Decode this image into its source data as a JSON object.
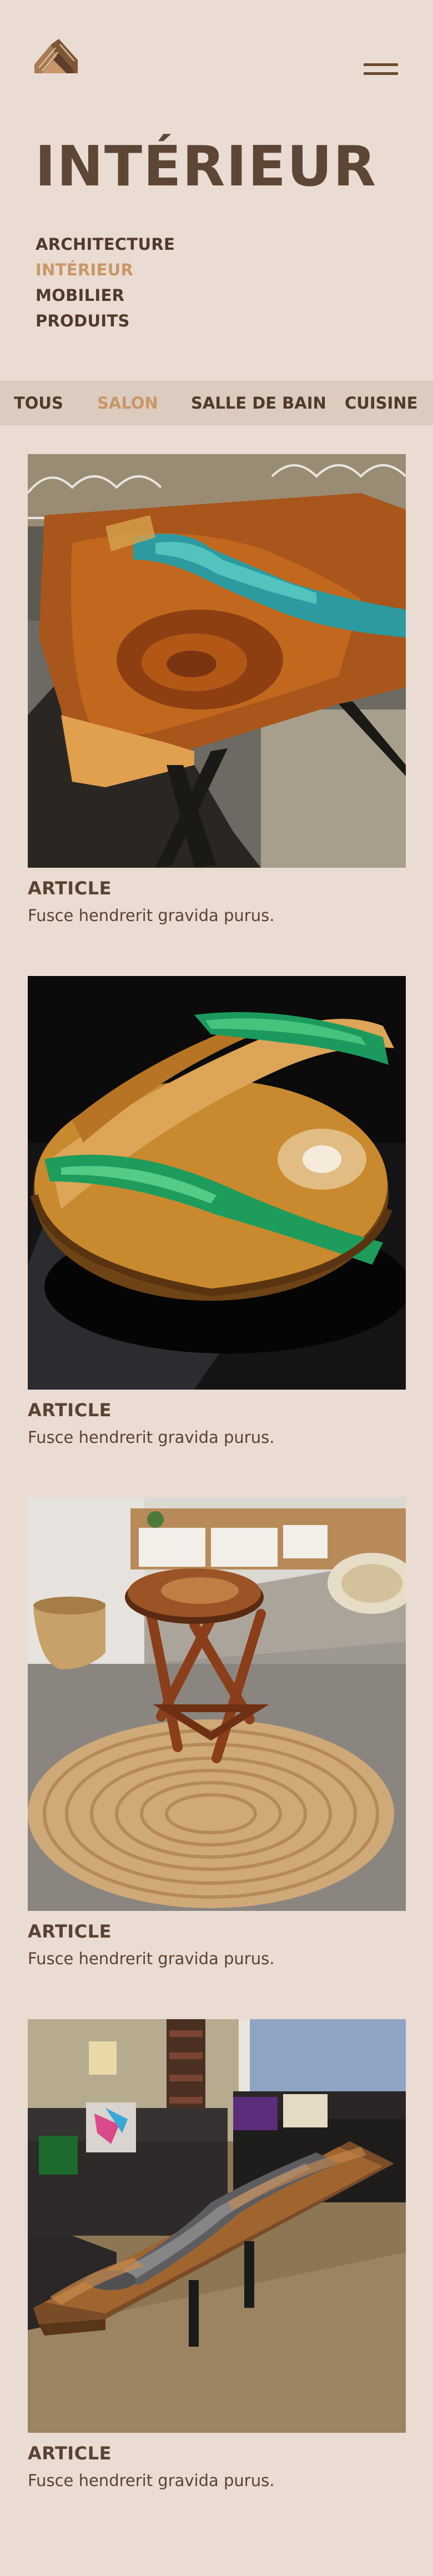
{
  "header": {
    "logo": "stacked-wood-planks-logo",
    "menu_icon": "hamburger-menu-icon",
    "title": "INTÉRIEUR"
  },
  "categories": [
    {
      "label": "ARCHITECTURE",
      "active": false
    },
    {
      "label": "INTÉRIEUR",
      "active": true
    },
    {
      "label": "MOBILIER",
      "active": false
    },
    {
      "label": "PRODUITS",
      "active": false
    }
  ],
  "tabs": [
    {
      "label": "TOUS",
      "active": false
    },
    {
      "label": "SALON",
      "active": true
    },
    {
      "label": "SALLE DE BAIN",
      "active": false
    },
    {
      "label": "CUISINE",
      "active": false
    }
  ],
  "articles": [
    {
      "title": "ARTICLE",
      "text": "Fusce hendrerit gravida purus.",
      "image": "live-edge wood table with turquoise resin river"
    },
    {
      "title": "ARTICLE",
      "text": "Fusce hendrerit gravida purus.",
      "image": "round wood table with green resin stripes"
    },
    {
      "title": "ARTICLE",
      "text": "Fusce hendrerit gravida purus.",
      "image": "round resin side table on jute rug"
    },
    {
      "title": "ARTICLE",
      "text": "Fusce hendrerit gravida purus.",
      "image": "walnut river coffee table in living room"
    }
  ],
  "colors": {
    "background": "#eadcd2",
    "tab_bar": "#dccbbf",
    "text": "#4f3a2d",
    "accent": "#c99768"
  }
}
